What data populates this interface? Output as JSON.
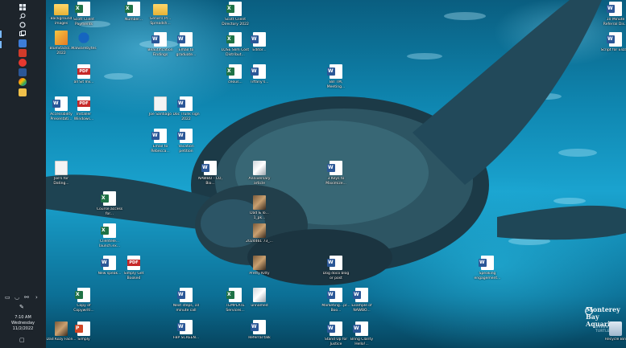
{
  "taskbar": {
    "icons": [
      "windows-start-icon",
      "search-icon",
      "cortana-icon",
      "task-view-icon",
      "app-icon",
      "app-icon",
      "app-icon",
      "app-icon",
      "app-icon",
      "app-icon",
      "app-icon"
    ],
    "clock": {
      "time": "7:10 AM",
      "day": "Wednesday",
      "date": "11/2/2022"
    }
  },
  "wallpaper": {
    "brand": "Monterey Bay Aquarium",
    "subtitle": "GREEN SEA TURTLE"
  },
  "desktop_icons": [
    {
      "type": "folder",
      "label": "Background images"
    },
    {
      "type": "excel",
      "label": "Scott Client Payments"
    },
    {
      "type": "excel",
      "label": "Number..."
    },
    {
      "type": "folder",
      "label": "Genie's Pr... Spreadsh..."
    },
    {
      "type": "excel",
      "label": "Scott Client Directory 2022"
    },
    {
      "type": "app",
      "label": "BlueStacks... 2022"
    },
    {
      "type": "mb",
      "label": "Malwarebytes"
    },
    {
      "type": "word",
      "label": "Beautification Findings"
    },
    {
      "type": "word",
      "label": "Email to graduate..."
    },
    {
      "type": "excel",
      "label": "LOSE Slim Cost Distribut..."
    },
    {
      "type": "word",
      "label": "Editor..."
    },
    {
      "type": "pdf",
      "label": "all Sit Inv..."
    },
    {
      "type": "excel",
      "label": "ceous..."
    },
    {
      "type": "word",
      "label": "Tiffany's..."
    },
    {
      "type": "word",
      "label": "Bill TM, Meeting..."
    },
    {
      "type": "word",
      "label": "Accessibility Presentati..."
    },
    {
      "type": "pdf",
      "label": "Installer Windows..."
    },
    {
      "type": "blank",
      "label": "Joe Santiago"
    },
    {
      "type": "word",
      "label": "Doc Trunk sign 2022"
    },
    {
      "type": "word",
      "label": "Vacation petition"
    },
    {
      "type": "word",
      "label": "Email to Rebecca..."
    },
    {
      "type": "blank",
      "label": "Joe's for Dating..."
    },
    {
      "type": "word",
      "label": "NAWBO - CO, Bio..."
    },
    {
      "type": "photo2",
      "label": "Anniversary article"
    },
    {
      "type": "word",
      "label": "3 Keys to Maximize..."
    },
    {
      "type": "excel",
      "label": "Course access for..."
    },
    {
      "type": "photo",
      "label": "Dad & lo... 1_pk..."
    },
    {
      "type": "excel",
      "label": "Clientele... launch.ex..."
    },
    {
      "type": "photo",
      "label": "2024461 73_..."
    },
    {
      "type": "word",
      "label": "New speak..."
    },
    {
      "type": "pdf",
      "label": "Simply Get Booked"
    },
    {
      "type": "photo",
      "label": "Pretty Kitty"
    },
    {
      "type": "word",
      "label": "Dog doco blog or post"
    },
    {
      "type": "word",
      "label": "Speaking engagement..."
    },
    {
      "type": "excel",
      "label": "Copy of Copywriti..."
    },
    {
      "type": "word",
      "label": "Next steps, 10 minute call"
    },
    {
      "type": "excel",
      "label": "TEMPLATE Services..."
    },
    {
      "type": "photo2",
      "label": "unnamed"
    },
    {
      "type": "word",
      "label": "Marketing...pr... Boo..."
    },
    {
      "type": "word",
      "label": "Example of NAWBO..."
    },
    {
      "type": "photo",
      "label": "Dad Kozy Face..."
    },
    {
      "type": "ppt",
      "label": "Simply"
    },
    {
      "type": "word",
      "label": "FBP SCREEN..."
    },
    {
      "type": "word",
      "label": "Referral talk"
    },
    {
      "type": "word",
      "label": "Stand Up for Justice"
    },
    {
      "type": "word",
      "label": "Bring Clarity Hello!..."
    },
    {
      "type": "word",
      "label": "10 Minute Referral Dis..."
    },
    {
      "type": "word",
      "label": "Script for Eliza..."
    },
    {
      "type": "recycle",
      "label": "Recycle Bin"
    }
  ]
}
